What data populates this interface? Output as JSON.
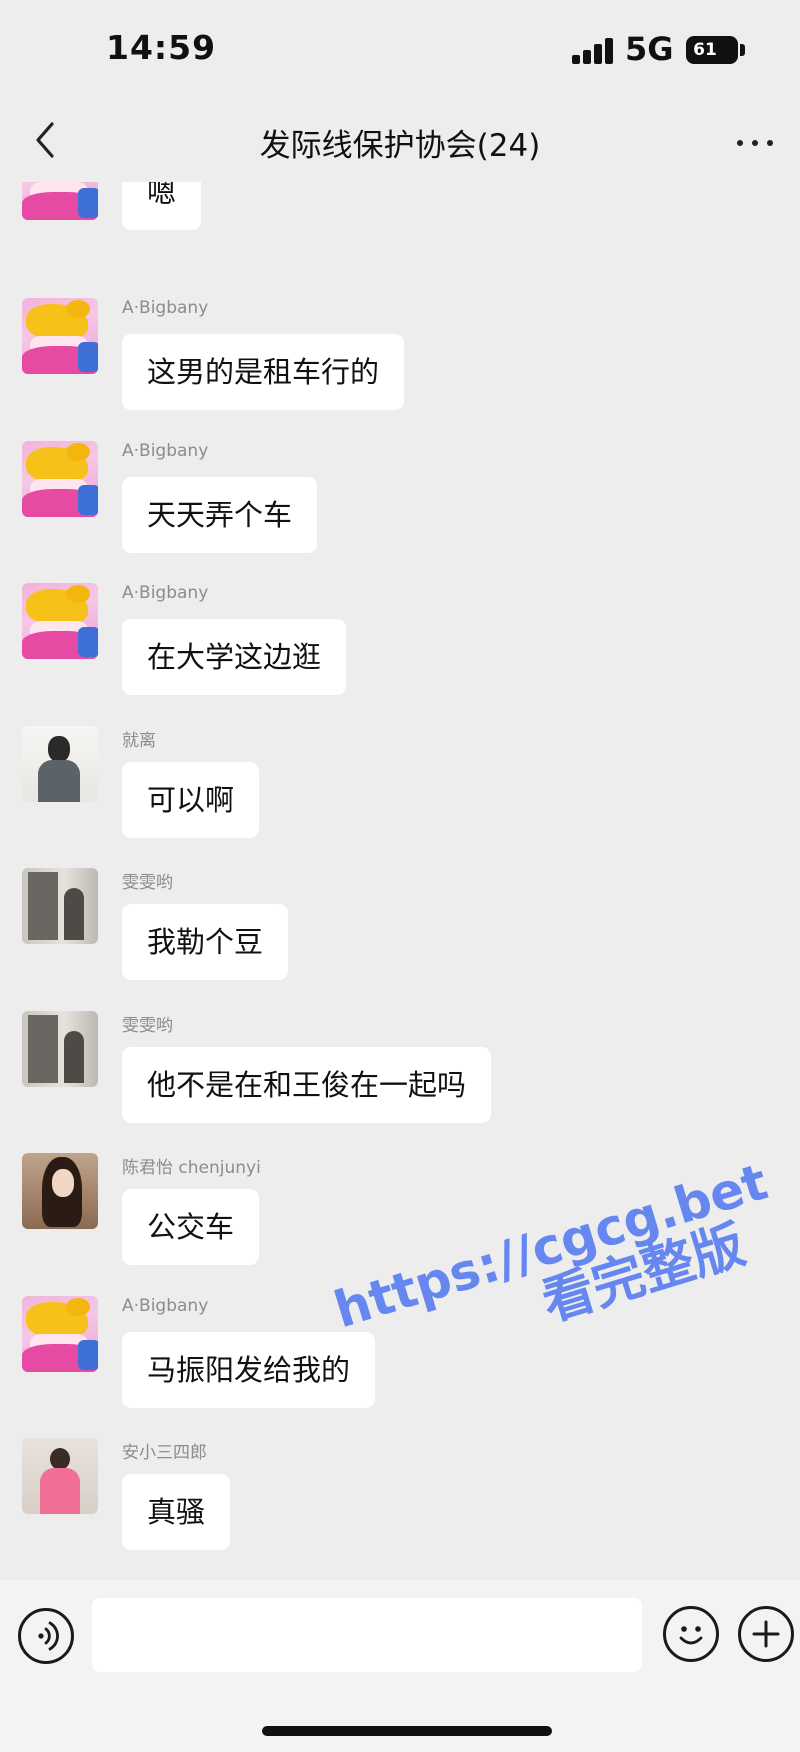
{
  "status_bar": {
    "time": "14:59",
    "network": "5G",
    "battery": "61"
  },
  "nav": {
    "title": "发际线保护协会(24)"
  },
  "messages": [
    {
      "sender": "",
      "text": "嗯",
      "avatar": "blonde-cartoon-avatar"
    },
    {
      "sender": "A·Bigbany",
      "text": "这男的是租车行的",
      "avatar": "blonde-cartoon-avatar"
    },
    {
      "sender": "A·Bigbany",
      "text": "天天弄个车",
      "avatar": "blonde-cartoon-avatar"
    },
    {
      "sender": "A·Bigbany",
      "text": "在大学这边逛",
      "avatar": "blonde-cartoon-avatar"
    },
    {
      "sender": "就离",
      "text": "可以啊",
      "avatar": "man-photo-avatar"
    },
    {
      "sender": "雯雯哟",
      "text": "我勒个豆",
      "avatar": "mirror-photo-avatar"
    },
    {
      "sender": "雯雯哟",
      "text": "他不是在和王俊在一起吗",
      "avatar": "mirror-photo-avatar"
    },
    {
      "sender": "陈君怡 chenjunyi",
      "text": "公交车",
      "avatar": "girl-photo-avatar"
    },
    {
      "sender": "A·Bigbany",
      "text": "马振阳发给我的",
      "avatar": "blonde-cartoon-avatar"
    },
    {
      "sender": "安小三四郎",
      "text": "真骚",
      "avatar": "pink-photo-avatar"
    }
  ],
  "watermark": {
    "url": "https://cgcg.bet",
    "text": "看完整版",
    "color": "#5b7ff0"
  },
  "input_bar": {
    "placeholder": "",
    "icons": [
      "voice-icon",
      "emoji-icon",
      "plus-icon"
    ]
  }
}
